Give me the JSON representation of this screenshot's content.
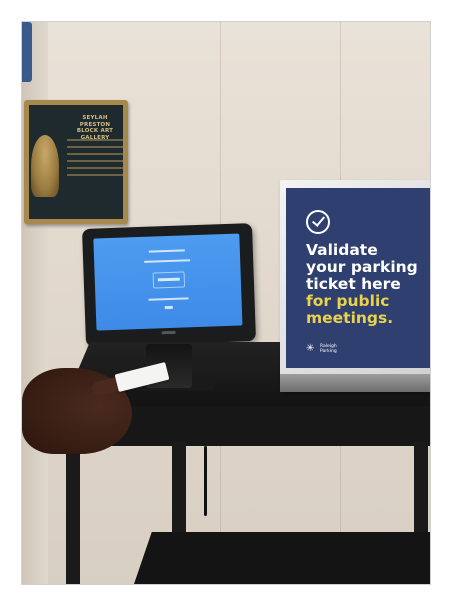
{
  "photo": {
    "colors": {
      "wall": "#e2d9cc",
      "sign_panel": "#2f3f70",
      "sign_accent": "#e8d34a",
      "tablet_screen": "#4d9cf0",
      "cart": "#171717",
      "plaque_frame": "#a6894c"
    }
  },
  "plaque": {
    "title_lines": [
      "SEYLAH PRESTON",
      "BLOCK ART GALLERY"
    ],
    "icon": "bust-relief"
  },
  "sign": {
    "icon": "check-circle-icon",
    "line1": "Validate",
    "line2": "your parking",
    "line3": "ticket here",
    "line4": "for public",
    "line5": "meetings.",
    "brand_mark": "✳",
    "brand_text": "Raleigh Parking"
  },
  "tablet": {
    "screen_state": "validation-screen",
    "icon": "tablet-kiosk-icon"
  },
  "hand": {
    "holding": "parking-ticket"
  }
}
